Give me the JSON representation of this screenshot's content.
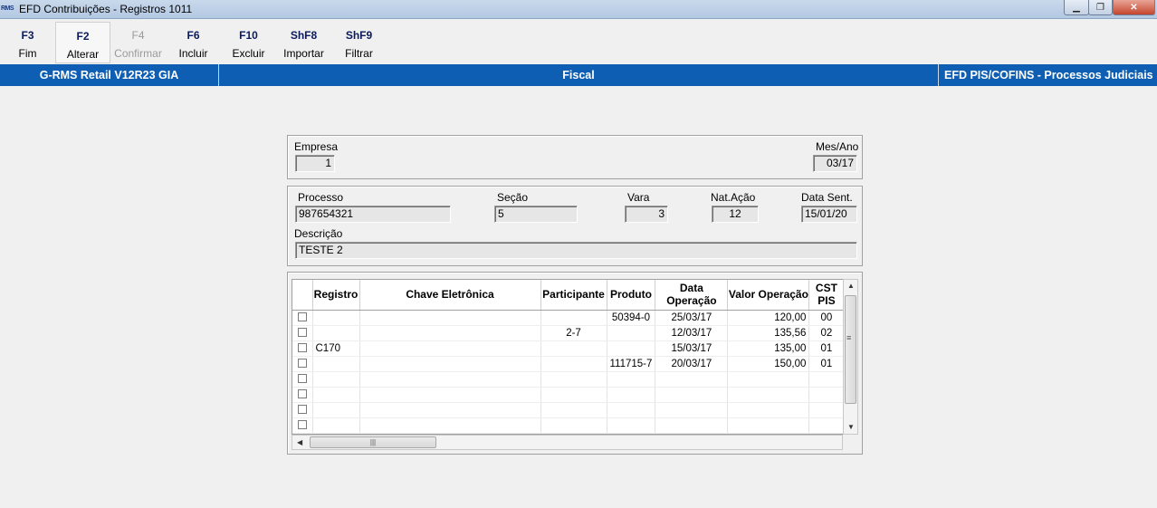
{
  "window": {
    "title": "EFD Contribuições - Registros 1011",
    "app_icon_text": "RMS"
  },
  "toolbar": [
    {
      "key": "F3",
      "label": "Fim",
      "state": "enabled"
    },
    {
      "key": "F2",
      "label": "Alterar",
      "state": "active"
    },
    {
      "key": "F4",
      "label": "Confirmar",
      "state": "disabled"
    },
    {
      "key": "F6",
      "label": "Incluir",
      "state": "enabled"
    },
    {
      "key": "F10",
      "label": "Excluir",
      "state": "enabled"
    },
    {
      "key": "ShF8",
      "label": "Importar",
      "state": "enabled"
    },
    {
      "key": "ShF9",
      "label": "Filtrar",
      "state": "enabled"
    }
  ],
  "infobar": {
    "left": "G-RMS Retail V12R23 GIA",
    "center": "Fiscal",
    "right": "EFD PIS/COFINS - Processos Judiciais"
  },
  "header": {
    "empresa_label": "Empresa",
    "empresa_value": "1",
    "mesano_label": "Mes/Ano",
    "mesano_value": "03/17"
  },
  "processo": {
    "processo_label": "Processo",
    "processo_value": "987654321",
    "secao_label": "Seção",
    "secao_value": "5",
    "vara_label": "Vara",
    "vara_value": "3",
    "natacao_label": "Nat.Ação",
    "natacao_value": "12",
    "datasent_label": "Data Sent.",
    "datasent_value": "15/01/20",
    "descricao_label": "Descrição",
    "descricao_value": "TESTE 2"
  },
  "grid": {
    "columns": [
      "Registro",
      "Chave Eletrônica",
      "Participante",
      "Produto",
      "Data Operação",
      "Valor Operação",
      "CST PIS"
    ],
    "rows": [
      {
        "registro": "",
        "chave": "",
        "participante": "",
        "produto": "50394-0",
        "data": "25/03/17",
        "valor": "120,00",
        "cst": "00"
      },
      {
        "registro": "",
        "chave": "",
        "participante": "2-7",
        "produto": "",
        "data": "12/03/17",
        "valor": "135,56",
        "cst": "02"
      },
      {
        "registro": "C170",
        "chave": "",
        "participante": "",
        "produto": "",
        "data": "15/03/17",
        "valor": "135,00",
        "cst": "01"
      },
      {
        "registro": "",
        "chave": "",
        "participante": "",
        "produto": "111715-7",
        "data": "20/03/17",
        "valor": "150,00",
        "cst": "01"
      },
      {
        "registro": "",
        "chave": "",
        "participante": "",
        "produto": "",
        "data": "",
        "valor": "",
        "cst": ""
      },
      {
        "registro": "",
        "chave": "",
        "participante": "",
        "produto": "",
        "data": "",
        "valor": "",
        "cst": ""
      },
      {
        "registro": "",
        "chave": "",
        "participante": "",
        "produto": "",
        "data": "",
        "valor": "",
        "cst": ""
      },
      {
        "registro": "",
        "chave": "",
        "participante": "",
        "produto": "",
        "data": "",
        "valor": "",
        "cst": ""
      }
    ]
  },
  "colors": {
    "infobar": "#0e5fb3",
    "toolbar_key": "#0a1a5c"
  }
}
